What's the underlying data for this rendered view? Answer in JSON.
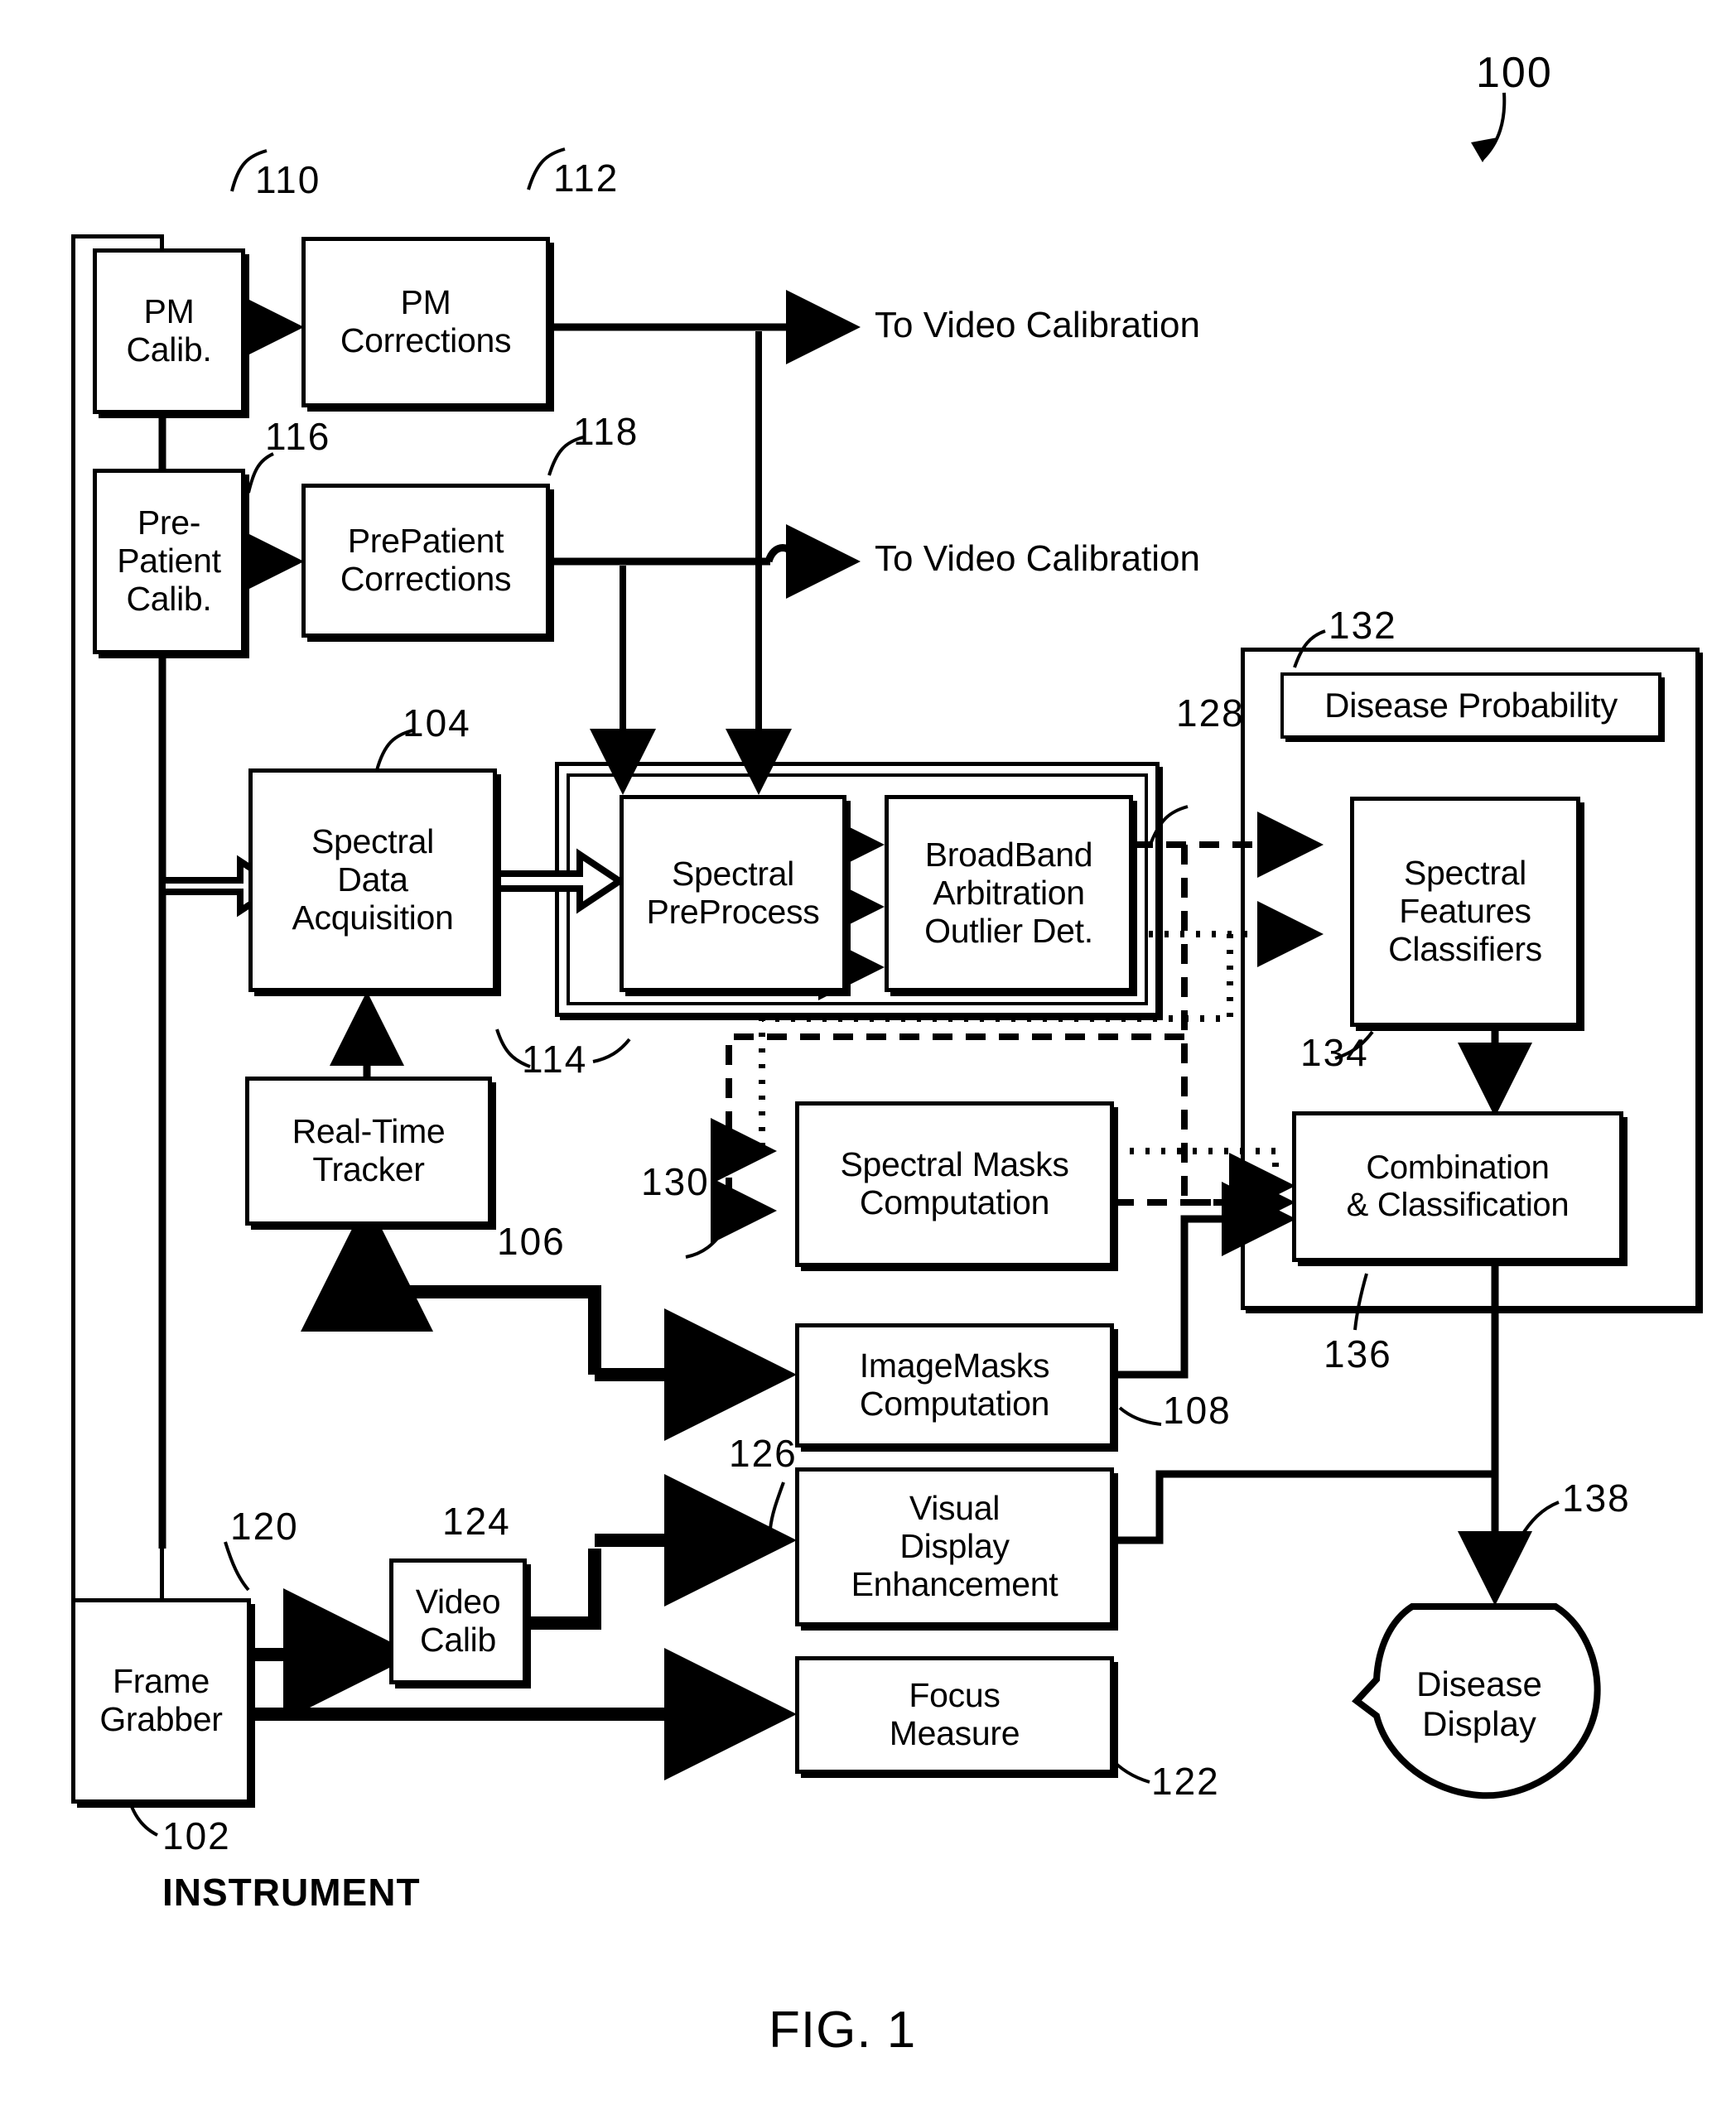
{
  "figure": {
    "label": "FIG. 1",
    "system_ref": "100",
    "instrument_label": "INSTRUMENT"
  },
  "blocks": {
    "pm_calib": {
      "label": "PM\nCalib.",
      "ref": "110"
    },
    "pm_corrections": {
      "label": "PM\nCorrections",
      "ref": "112"
    },
    "prepatient_calib": {
      "label": "Pre-\nPatient\nCalib.",
      "ref": "116"
    },
    "prepatient_corr": {
      "label": "PrePatient\nCorrections",
      "ref": "118"
    },
    "spectral_acq": {
      "label": "Spectral\nData\nAcquisition",
      "ref": "104"
    },
    "spectral_preprocess": {
      "label": "Spectral\nPreProcess",
      "ref": "114"
    },
    "broadband": {
      "label": "BroadBand\nArbitration\nOutlier Det.",
      "ref": "128"
    },
    "realtime_tracker": {
      "label": "Real-Time\nTracker",
      "ref": "106"
    },
    "spectral_masks": {
      "label": "Spectral Masks\nComputation",
      "ref": "130"
    },
    "image_masks": {
      "label": "ImageMasks\nComputation",
      "ref": "108"
    },
    "visual_display": {
      "label": "Visual\nDisplay\nEnhancement",
      "ref": "126"
    },
    "focus_measure": {
      "label": "Focus\nMeasure",
      "ref": "122"
    },
    "frame_grabber": {
      "label": "Frame\nGrabber",
      "ref": "102"
    },
    "video_calib": {
      "label": "Video\nCalib",
      "ref": "124"
    },
    "disease_probability": {
      "label": "Disease Probability",
      "ref": "132"
    },
    "spectral_features": {
      "label": "Spectral\nFeatures\nClassifiers",
      "ref": "134"
    },
    "combination": {
      "label": "Combination\n& Classification",
      "ref": "136"
    },
    "disease_display": {
      "label": "Disease\nDisplay",
      "ref": "138"
    }
  },
  "annotations": {
    "to_video_calibration_1": "To Video Calibration",
    "to_video_calibration_2": "To Video Calibration"
  },
  "colors": {
    "line": "#000000",
    "background": "#ffffff"
  }
}
